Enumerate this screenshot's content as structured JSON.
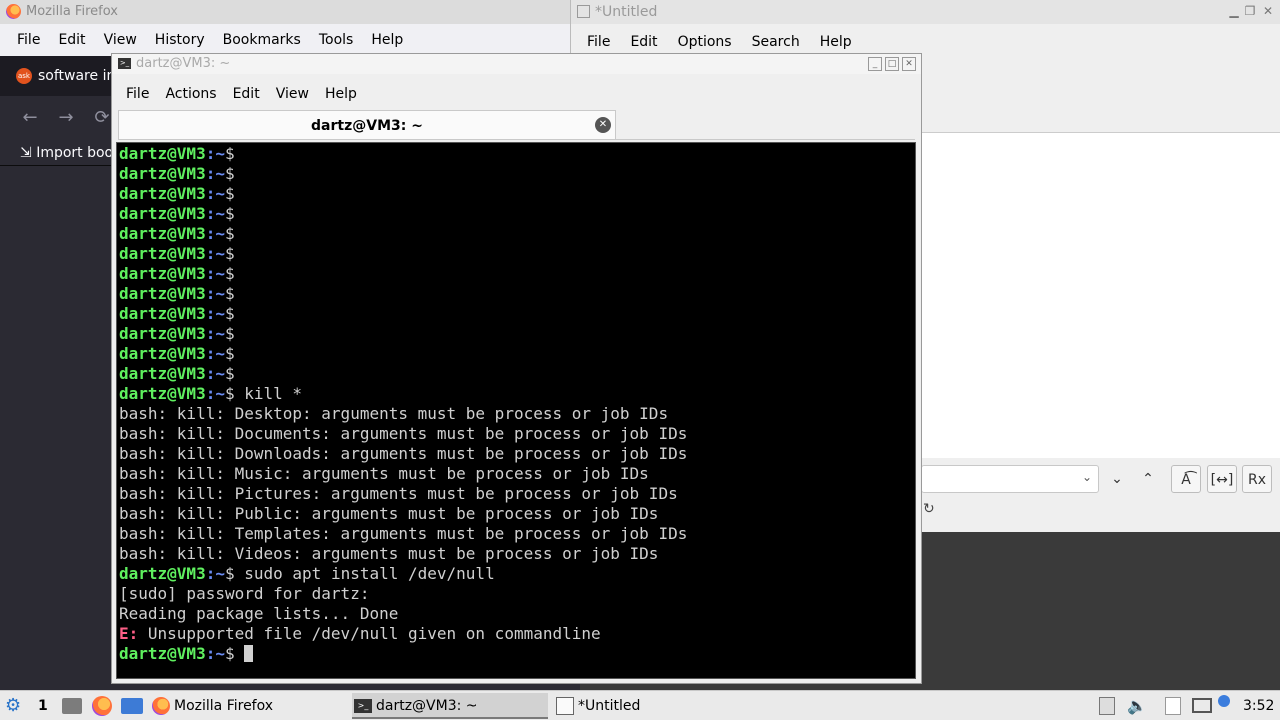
{
  "firefox": {
    "title": "Mozilla Firefox",
    "menu": [
      "File",
      "Edit",
      "View",
      "History",
      "Bookmarks",
      "Tools",
      "Help"
    ],
    "tab_title": "software in",
    "tab_favicon_text": "ask",
    "import_bookmarks": "Import boo",
    "nav": {
      "back": "←",
      "forward": "→",
      "reload": "⟳"
    }
  },
  "featherpad": {
    "title": "*Untitled",
    "menu": [
      "File",
      "Edit",
      "Options",
      "Search",
      "Help"
    ],
    "window_controls": [
      "▁",
      "❐",
      "✕"
    ],
    "find_buttons": [
      "⌄",
      "⌃",
      "A͡",
      "[↔]",
      "Rx"
    ],
    "reload_glyph": "↻"
  },
  "terminal": {
    "title": "dartz@VM3: ~",
    "menu": [
      "File",
      "Actions",
      "Edit",
      "View",
      "Help"
    ],
    "tab_title": "dartz@VM3: ~",
    "prompt_user": "dartz@VM3",
    "prompt_path": ":~",
    "prompt_sign": "$",
    "empty_prompt_count": 12,
    "lines": [
      {
        "type": "prompt",
        "cmd": ""
      },
      {
        "type": "prompt",
        "cmd": ""
      },
      {
        "type": "prompt",
        "cmd": ""
      },
      {
        "type": "prompt",
        "cmd": ""
      },
      {
        "type": "prompt",
        "cmd": ""
      },
      {
        "type": "prompt",
        "cmd": ""
      },
      {
        "type": "prompt",
        "cmd": ""
      },
      {
        "type": "prompt",
        "cmd": ""
      },
      {
        "type": "prompt",
        "cmd": ""
      },
      {
        "type": "prompt",
        "cmd": ""
      },
      {
        "type": "prompt",
        "cmd": ""
      },
      {
        "type": "prompt",
        "cmd": ""
      },
      {
        "type": "prompt",
        "cmd": " kill *"
      },
      {
        "type": "out",
        "text": "bash: kill: Desktop: arguments must be process or job IDs"
      },
      {
        "type": "out",
        "text": "bash: kill: Documents: arguments must be process or job IDs"
      },
      {
        "type": "out",
        "text": "bash: kill: Downloads: arguments must be process or job IDs"
      },
      {
        "type": "out",
        "text": "bash: kill: Music: arguments must be process or job IDs"
      },
      {
        "type": "out",
        "text": "bash: kill: Pictures: arguments must be process or job IDs"
      },
      {
        "type": "out",
        "text": "bash: kill: Public: arguments must be process or job IDs"
      },
      {
        "type": "out",
        "text": "bash: kill: Templates: arguments must be process or job IDs"
      },
      {
        "type": "out",
        "text": "bash: kill: Videos: arguments must be process or job IDs"
      },
      {
        "type": "prompt",
        "cmd": " sudo apt install /dev/null"
      },
      {
        "type": "out",
        "text": "[sudo] password for dartz:"
      },
      {
        "type": "out",
        "text": "Reading package lists... Done"
      },
      {
        "type": "error",
        "prefix": "E:",
        "text": " Unsupported file /dev/null given on commandline"
      },
      {
        "type": "prompt",
        "cmd": " ",
        "cursor": true
      }
    ]
  },
  "taskbar": {
    "workspace": "1",
    "tasks": [
      {
        "label": "Mozilla Firefox",
        "icon": "firefox-icon",
        "active": false
      },
      {
        "label": "dartz@VM3: ~",
        "icon": "terminal-icon",
        "active": true
      },
      {
        "label": "*Untitled",
        "icon": "featherpad-icon",
        "active": false
      }
    ],
    "clock": "3:52"
  }
}
